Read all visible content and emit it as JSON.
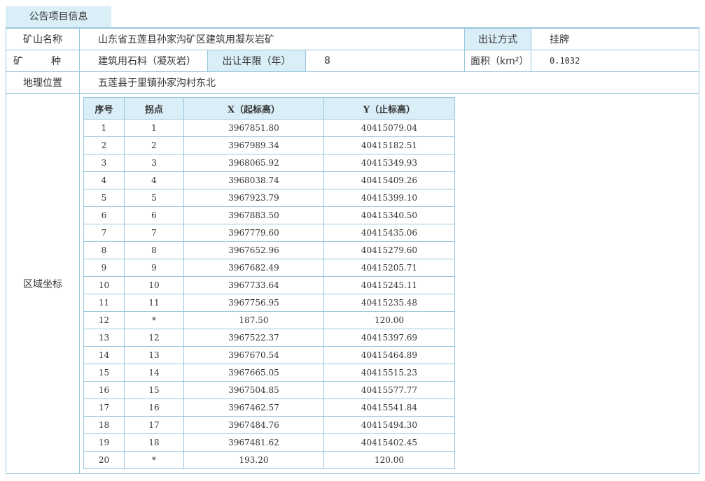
{
  "tab": {
    "label": "公告项目信息"
  },
  "row1": {
    "mine_name_label": "矿山名称",
    "mine_name": "山东省五莲县孙家沟矿区建筑用凝灰岩矿",
    "method_label": "出让方式",
    "method": "挂牌"
  },
  "row2": {
    "type_label_a": "矿",
    "type_label_b": "种",
    "type": "建筑用石料（凝灰岩）",
    "years_label": "出让年限（年）",
    "years": "8",
    "area_label": "面积（km²）",
    "area": "0.1032"
  },
  "row3": {
    "loc_label": "地理位置",
    "loc": "五莲县于里镇孙家沟村东北"
  },
  "row4": {
    "coords_label": "区域坐标"
  },
  "coords": {
    "headers": [
      "序号",
      "拐点",
      "X（起标高）",
      "Y（止标高）"
    ],
    "rows": [
      [
        "1",
        "1",
        "3967851.80",
        "40415079.04"
      ],
      [
        "2",
        "2",
        "3967989.34",
        "40415182.51"
      ],
      [
        "3",
        "3",
        "3968065.92",
        "40415349.93"
      ],
      [
        "4",
        "4",
        "3968038.74",
        "40415409.26"
      ],
      [
        "5",
        "5",
        "3967923.79",
        "40415399.10"
      ],
      [
        "6",
        "6",
        "3967883.50",
        "40415340.50"
      ],
      [
        "7",
        "7",
        "3967779.60",
        "40415435.06"
      ],
      [
        "8",
        "8",
        "3967652.96",
        "40415279.60"
      ],
      [
        "9",
        "9",
        "3967682.49",
        "40415205.71"
      ],
      [
        "10",
        "10",
        "3967733.64",
        "40415245.11"
      ],
      [
        "11",
        "11",
        "3967756.95",
        "40415235.48"
      ],
      [
        "12",
        "*",
        "187.50",
        "120.00"
      ],
      [
        "13",
        "12",
        "3967522.37",
        "40415397.69"
      ],
      [
        "14",
        "13",
        "3967670.54",
        "40415464.89"
      ],
      [
        "15",
        "14",
        "3967665.05",
        "40415515.23"
      ],
      [
        "16",
        "15",
        "3967504.85",
        "40415577.77"
      ],
      [
        "17",
        "16",
        "3967462.57",
        "40415541.84"
      ],
      [
        "18",
        "17",
        "3967484.76",
        "40415494.30"
      ],
      [
        "19",
        "18",
        "3967481.62",
        "40415402.45"
      ],
      [
        "20",
        "*",
        "193.20",
        "120.00"
      ]
    ]
  }
}
